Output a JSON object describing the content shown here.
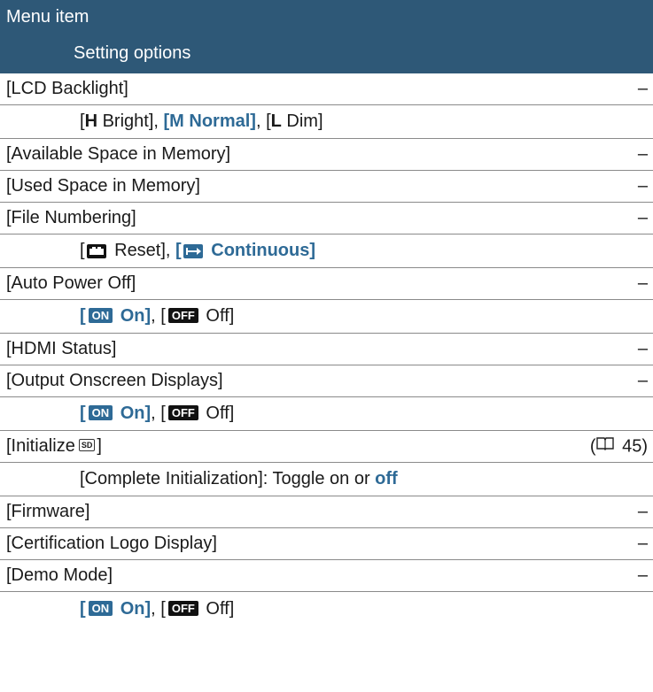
{
  "header": {
    "title": "Menu item",
    "subtitle": "Setting options"
  },
  "rows": {
    "lcd": {
      "label": "[LCD Backlight]",
      "ref": "–"
    },
    "lcd_opts": {
      "b1": "[",
      "h": "H",
      "bright": " Bright], ",
      "m_normal": "[M Normal]",
      "sep": ", [",
      "l": "L",
      "dim": " Dim]"
    },
    "avail": {
      "label": "[Available Space in Memory]",
      "ref": "–"
    },
    "used": {
      "label": "[Used Space in Memory]",
      "ref": "–"
    },
    "filenum": {
      "label": "[File Numbering]",
      "ref": "–"
    },
    "filenum_opts": {
      "b1": "[",
      "reset": " Reset], ",
      "cont_open": "[",
      "cont": " Continuous]"
    },
    "autopower": {
      "label": "[Auto Power Off]",
      "ref": "–"
    },
    "autopower_opts": {
      "on_open": "[",
      "on_chip": "ON",
      "on_text": " On]",
      "sep": ", [",
      "off_chip": "OFF",
      "off_text": " Off]"
    },
    "hdmi": {
      "label": "[HDMI Status]",
      "ref": "–"
    },
    "osd": {
      "label": "[Output Onscreen Displays]",
      "ref": "–"
    },
    "osd_opts": {
      "on_open": "[",
      "on_chip": "ON",
      "on_text": " On]",
      "sep": ", [",
      "off_chip": "OFF",
      "off_text": " Off]"
    },
    "init": {
      "label_open": "[Initialize",
      "sd": "SD",
      "label_close": "]",
      "ref_open": "(",
      "ref_page": " 45)"
    },
    "init_opts": {
      "text": "[Complete Initialization]: Toggle on or ",
      "off": "off"
    },
    "firmware": {
      "label": "[Firmware]",
      "ref": "–"
    },
    "cert": {
      "label": "[Certification Logo Display]",
      "ref": "–"
    },
    "demo": {
      "label": "[Demo Mode]",
      "ref": "–"
    },
    "demo_opts": {
      "on_open": "[",
      "on_chip": "ON",
      "on_text": " On]",
      "sep": ", [",
      "off_chip": "OFF",
      "off_text": " Off]"
    }
  },
  "colors": {
    "header_bg": "#2e5877",
    "accent": "#2e6a96"
  },
  "icons": {
    "reset": "file-numbering-reset-icon",
    "continuous": "file-numbering-continuous-icon",
    "sd": "sd-card-icon",
    "ref": "book-reference-icon"
  }
}
